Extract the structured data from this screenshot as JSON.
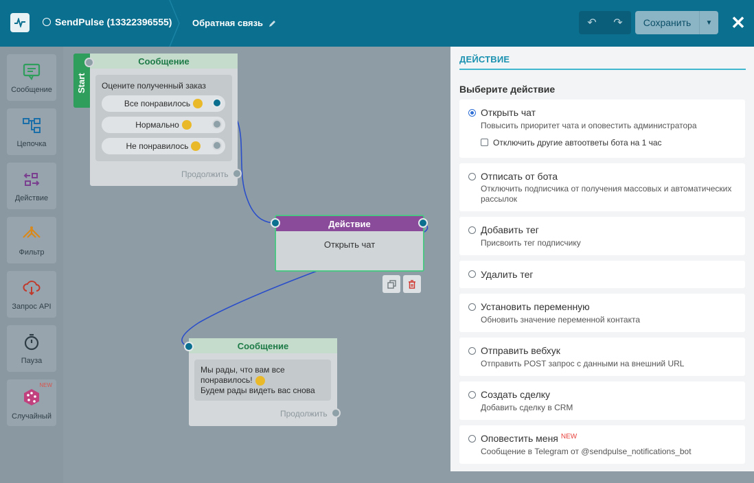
{
  "header": {
    "bot_name": "SendPulse (13322396555)",
    "flow_name": "Обратная связь",
    "save_label": "Сохранить",
    "close_label": "✕"
  },
  "tools": [
    {
      "label": "Сообщение",
      "icon": "message-icon"
    },
    {
      "label": "Цепочка",
      "icon": "chain-icon"
    },
    {
      "label": "Действие",
      "icon": "action-icon"
    },
    {
      "label": "Фильтр",
      "icon": "filter-icon"
    },
    {
      "label": "Запрос API",
      "icon": "api-icon"
    },
    {
      "label": "Пауза",
      "icon": "pause-icon"
    },
    {
      "label": "Случайный",
      "icon": "random-icon",
      "badge": "NEW"
    }
  ],
  "canvas": {
    "start_label": "Start",
    "node1": {
      "title": "Сообщение",
      "text": "Оцените полученный заказ",
      "buttons": [
        "Все понравилось",
        "Нормально",
        "Не понравилось"
      ],
      "continue": "Продолжить"
    },
    "action_node": {
      "title": "Действие",
      "text": "Открыть чат"
    },
    "node2": {
      "title": "Сообщение",
      "line1": "Мы рады, что вам все",
      "line2": "понравилось!",
      "line3": "Будем рады видеть вас снова",
      "continue": "Продолжить"
    }
  },
  "panel": {
    "title": "ДЕЙСТВИЕ",
    "subtitle": "Выберите действие",
    "options": [
      {
        "label": "Открыть чат",
        "desc": "Повысить приоритет чата и оповестить администратора",
        "selected": true,
        "checkbox": "Отключить другие автоответы бота на 1 час"
      },
      {
        "label": "Отписать от бота",
        "desc": "Отключить подписчика от получения массовых и автоматических рассылок"
      },
      {
        "label": "Добавить тег",
        "desc": "Присвоить тег подписчику"
      },
      {
        "label": "Удалить тег",
        "desc": ""
      },
      {
        "label": "Установить переменную",
        "desc": "Обновить значение переменной контакта"
      },
      {
        "label": "Отправить вебхук",
        "desc": "Отправить POST запрос с данными на внешний URL"
      },
      {
        "label": "Создать сделку",
        "desc": "Добавить сделку в CRM"
      },
      {
        "label": "Оповестить меня",
        "badge": "NEW",
        "desc": "Сообщение в Telegram от @sendpulse_notifications_bot"
      }
    ]
  },
  "colors": {
    "header": "#0b6f8f",
    "accent": "#1a91b0",
    "action_head": "#8a4c9a",
    "message_head": "#1d7a46",
    "start": "#2f9d5c"
  }
}
